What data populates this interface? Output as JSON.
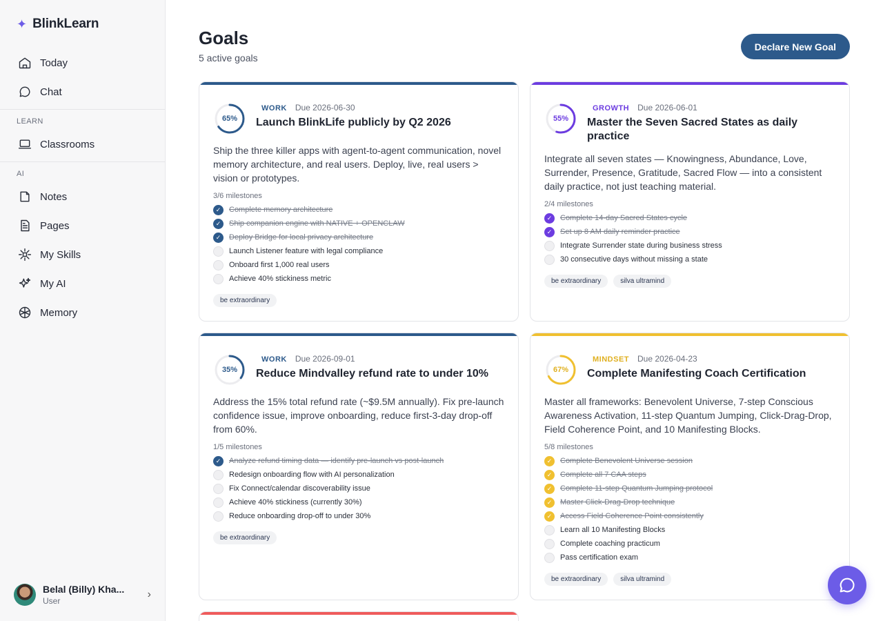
{
  "app": {
    "name": "BlinkLearn"
  },
  "nav": {
    "today": "Today",
    "chat": "Chat",
    "learn_section": "LEARN",
    "classrooms": "Classrooms",
    "ai_section": "AI",
    "notes": "Notes",
    "pages": "Pages",
    "my_skills": "My Skills",
    "my_ai": "My AI",
    "memory": "Memory"
  },
  "user": {
    "name": "Belal (Billy) Kha...",
    "role": "User"
  },
  "header": {
    "title": "Goals",
    "subtitle": "5 active goals",
    "declare_button": "Declare New Goal"
  },
  "colors": {
    "work": "#2d5a8b",
    "growth": "#6c3ce0",
    "mindset": "#f0c030",
    "urgent": "#ef5b5b"
  },
  "goals": [
    {
      "category": "WORK",
      "due": "Due 2026-06-30",
      "progress_label": "65%",
      "progress": 0.65,
      "title": "Launch BlinkLife publicly by Q2 2026",
      "description": "Ship the three killer apps with agent-to-agent communication, novel memory architecture, and real users. Deploy, live, real users > vision or prototypes.",
      "milestone_count": "3/6 milestones",
      "milestones": [
        {
          "label": "Complete memory architecture",
          "done": true
        },
        {
          "label": "Ship companion engine with NATIVE + OPENCLAW",
          "done": true
        },
        {
          "label": "Deploy Bridge for local privacy architecture",
          "done": true
        },
        {
          "label": "Launch Listener feature with legal compliance",
          "done": false
        },
        {
          "label": "Onboard first 1,000 real users",
          "done": false
        },
        {
          "label": "Achieve 40% stickiness metric",
          "done": false
        }
      ],
      "tags": [
        "be extraordinary"
      ]
    },
    {
      "category": "GROWTH",
      "due": "Due 2026-06-01",
      "progress_label": "55%",
      "progress": 0.55,
      "title": "Master the Seven Sacred States as daily practice",
      "description": "Integrate all seven states — Knowingness, Abundance, Love, Surrender, Presence, Gratitude, Sacred Flow — into a consistent daily practice, not just teaching material.",
      "milestone_count": "2/4 milestones",
      "milestones": [
        {
          "label": "Complete 14-day Sacred States cycle",
          "done": true
        },
        {
          "label": "Set up 8 AM daily reminder practice",
          "done": true
        },
        {
          "label": "Integrate Surrender state during business stress",
          "done": false
        },
        {
          "label": "30 consecutive days without missing a state",
          "done": false
        }
      ],
      "tags": [
        "be extraordinary",
        "silva ultramind"
      ]
    },
    {
      "category": "WORK",
      "due": "Due 2026-09-01",
      "progress_label": "35%",
      "progress": 0.35,
      "title": "Reduce Mindvalley refund rate to under 10%",
      "description": "Address the 15% total refund rate (~$9.5M annually). Fix pre-launch confidence issue, improve onboarding, reduce first-3-day drop-off from 60%.",
      "milestone_count": "1/5 milestones",
      "milestones": [
        {
          "label": "Analyze refund timing data — identify pre-launch vs post-launch",
          "done": true
        },
        {
          "label": "Redesign onboarding flow with AI personalization",
          "done": false
        },
        {
          "label": "Fix Connect/calendar discoverability issue",
          "done": false
        },
        {
          "label": "Achieve 40% stickiness (currently 30%)",
          "done": false
        },
        {
          "label": "Reduce onboarding drop-off to under 30%",
          "done": false
        }
      ],
      "tags": [
        "be extraordinary"
      ]
    },
    {
      "category": "MINDSET",
      "due": "Due 2026-04-23",
      "progress_label": "67%",
      "progress": 0.67,
      "title": "Complete Manifesting Coach Certification",
      "description": "Master all frameworks: Benevolent Universe, 7-step Conscious Awareness Activation, 11-step Quantum Jumping, Click-Drag-Drop, Field Coherence Point, and 10 Manifesting Blocks.",
      "milestone_count": "5/8 milestones",
      "milestones": [
        {
          "label": "Complete Benevolent Universe session",
          "done": true
        },
        {
          "label": "Complete all 7 CAA steps",
          "done": true
        },
        {
          "label": "Complete 11-step Quantum Jumping protocol",
          "done": true
        },
        {
          "label": "Master Click-Drag-Drop technique",
          "done": true
        },
        {
          "label": "Access Field Coherence Point consistently",
          "done": true
        },
        {
          "label": "Learn all 10 Manifesting Blocks",
          "done": false
        },
        {
          "label": "Complete coaching practicum",
          "done": false
        },
        {
          "label": "Pass certification exam",
          "done": false
        }
      ],
      "tags": [
        "be extraordinary",
        "silva ultramind"
      ]
    }
  ]
}
